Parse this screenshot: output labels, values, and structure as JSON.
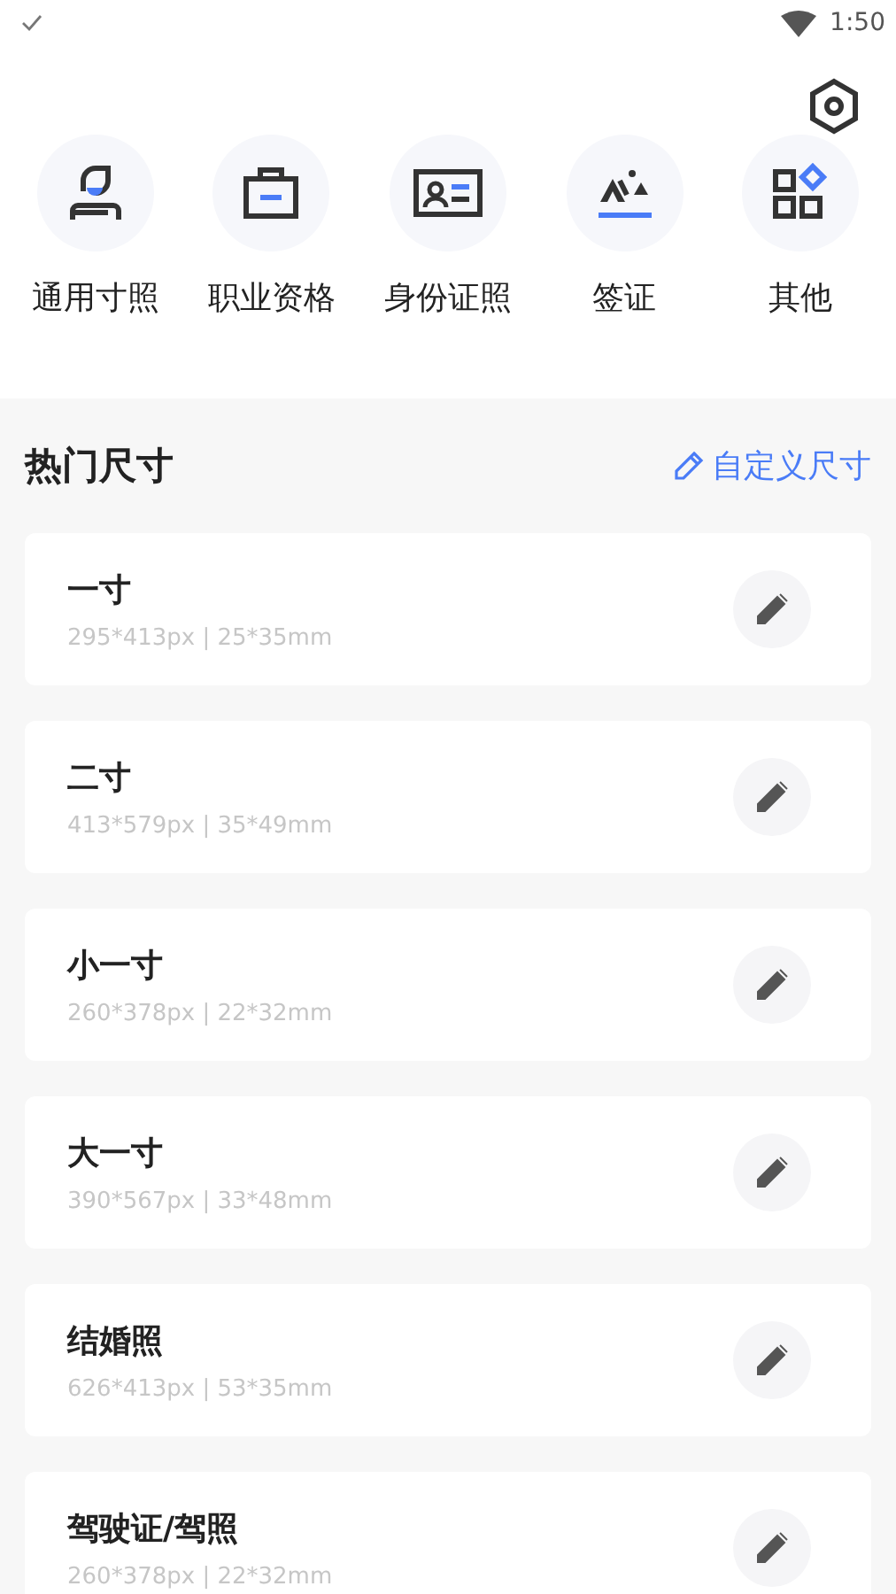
{
  "status_bar": {
    "time": "1:50"
  },
  "categories": [
    {
      "label": "通用寸照"
    },
    {
      "label": "职业资格"
    },
    {
      "label": "身份证照"
    },
    {
      "label": "签证"
    },
    {
      "label": "其他"
    }
  ],
  "section": {
    "title": "热门尺寸",
    "action": "自定义尺寸"
  },
  "sizes": [
    {
      "name": "一寸",
      "spec": "295*413px | 25*35mm"
    },
    {
      "name": "二寸",
      "spec": "413*579px | 35*49mm"
    },
    {
      "name": "小一寸",
      "spec": "260*378px | 22*32mm"
    },
    {
      "name": "大一寸",
      "spec": "390*567px | 33*48mm"
    },
    {
      "name": "结婚照",
      "spec": "626*413px | 53*35mm"
    },
    {
      "name": "驾驶证/驾照",
      "spec": "260*378px | 22*32mm"
    }
  ]
}
